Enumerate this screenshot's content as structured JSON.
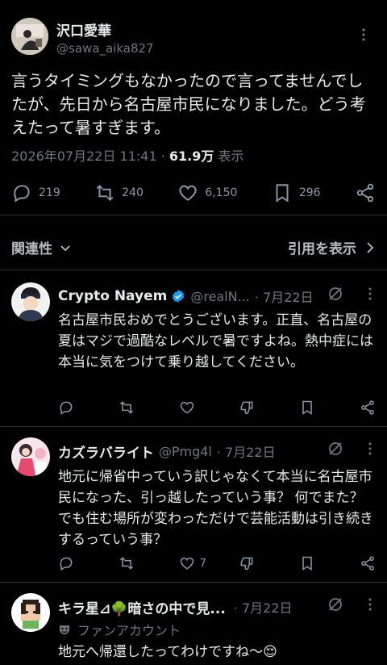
{
  "main": {
    "name": "沢口愛華",
    "handle": "@sawa_aika827",
    "text": "言うタイミングもなかったので言ってませんでしたが、先日から名古屋市民になりました。どう考えたって暑すぎます。",
    "timestamp": "2026年07月22日 11:41 · ",
    "views_count": "61.9万",
    "views_label": " 表示",
    "replies": "219",
    "retweets": "240",
    "likes": "6,150",
    "bookmarks": "296"
  },
  "sort": {
    "left_label": "関連性",
    "right_label": "引用を表示"
  },
  "replies": [
    {
      "name": "Crypto Nayem",
      "handle": "@realN...",
      "date": "· 7月22日",
      "text": "名古屋市民おめでとうございます。正直、名古屋の夏はマジで過酷なレベルで暑ですよね。熱中症には本当に気をつけて乗り越してください。",
      "likes": ""
    },
    {
      "name": "カズラバライト",
      "handle": "@Pmg4l",
      "date": "· 7月22日",
      "text": "地元に帰省中っていう訳じゃなくて本当に名古屋市民になった、引っ越したっていう事？ 何でまた？ でも住む場所が変わっただけで芸能活動は引き続きするっていう事？",
      "likes": "7"
    },
    {
      "name": "キラ星⊿🌳暗さの中で見...",
      "handle": "",
      "date": "· 7月22日",
      "fan_label": "ファンアカウント",
      "text": "地元へ帰還したってわけですね〜😌"
    }
  ],
  "colors": {
    "background": "#000000",
    "text": "#e7e9ea",
    "muted": "#71767b",
    "verified": "#1d9bf0",
    "divider": "#2f3336"
  }
}
